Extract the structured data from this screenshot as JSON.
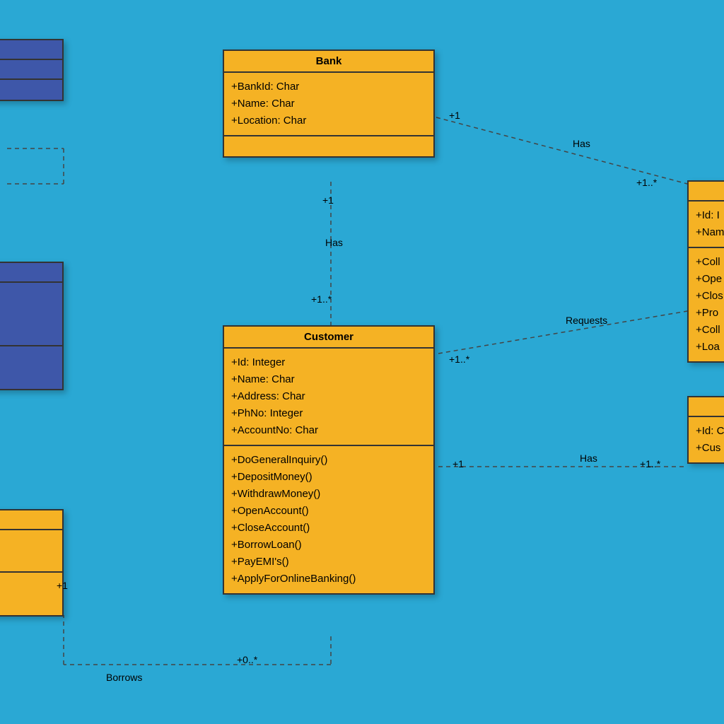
{
  "classes": {
    "bank": {
      "title": "Bank",
      "attrs": [
        "+BankId: Char",
        "+Name: Char",
        "+Location: Char"
      ]
    },
    "customer": {
      "title": "Customer",
      "attrs": [
        "+Id: Integer",
        "+Name: Char",
        "+Address: Char",
        "+PhNo: Integer",
        "+AccountNo: Char"
      ],
      "methods": [
        "+DoGeneralInquiry()",
        "+DepositMoney()",
        "+WithdrawMoney()",
        "+OpenAccount()",
        "+CloseAccount()",
        "+BorrowLoan()",
        "+PayEMI's()",
        "+ApplyForOnlineBanking()"
      ]
    },
    "teller": {
      "attrs": [
        "+Id: I",
        "+Nam"
      ],
      "methods": [
        "+Coll",
        "+Ope",
        "+Clos",
        "+Pro",
        "+Coll",
        "+Loa"
      ]
    },
    "account": {
      "attrs": [
        "+Id: C",
        "+Cus"
      ]
    }
  },
  "relations": {
    "bank_teller": {
      "label": "Has",
      "left": "+1",
      "right": "+1..*"
    },
    "bank_customer": {
      "label": "Has",
      "top": "+1",
      "bottom": "+1..*"
    },
    "customer_teller": {
      "label": "Requests",
      "left": "+1..*"
    },
    "customer_account": {
      "label": "Has",
      "left": "+1",
      "right": "+1..*"
    },
    "customer_loan": {
      "label": "Borrows",
      "left": "+1",
      "right": "+0..*"
    }
  }
}
